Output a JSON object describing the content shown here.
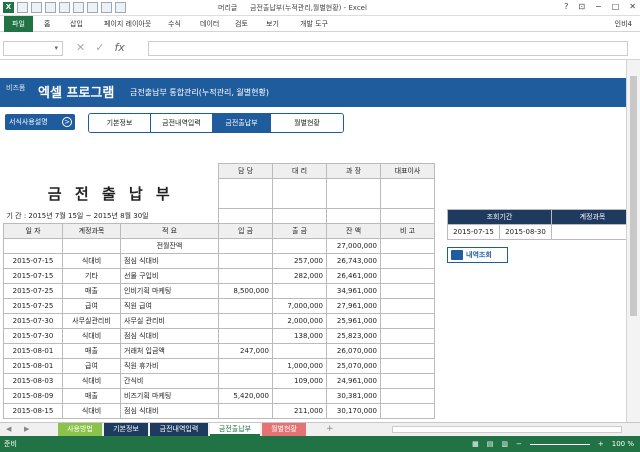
{
  "window": {
    "title": "금전출납부(누적관리,월별현황) - Excel",
    "controls": [
      "?",
      "⊡",
      "−",
      "□",
      "✕"
    ]
  },
  "qat_icons": [
    "excel-icon",
    "save-icon",
    "undo-icon",
    "redo-icon",
    "open-icon",
    "new-icon",
    "print-icon",
    "preview-icon",
    "checkbox-icon"
  ],
  "qat_label": "머리글",
  "ribbon": {
    "file": "파일",
    "tabs": [
      "홈",
      "삽입",
      "페이지 레이아웃",
      "수식",
      "데이터",
      "검토",
      "보기",
      "개발 도구"
    ],
    "user": "인비4"
  },
  "formula": {
    "name_box": "▾",
    "fx": "fx"
  },
  "banner": {
    "brand": "비즈폼",
    "program": "엑셀 프로그램",
    "subtitle": "금전출납부 통합관리(누적관리, 월별현황)"
  },
  "help_button": "서식사용설명",
  "help_icon": ">",
  "nav_tabs": [
    "기본정보",
    "금전내역입력",
    "금전출납부",
    "월별현황"
  ],
  "ledger": {
    "title": "금 전 출 납 부",
    "period": "기 간 : 2015년 7월 15일 ~ 2015년 8월 30일",
    "sign_headers": [
      "담 당",
      "대 리",
      "과 장",
      "대표이사"
    ],
    "columns": [
      "일 자",
      "계정과목",
      "적 요",
      "입 금",
      "출 금",
      "잔 액",
      "비 고"
    ],
    "opening": {
      "label": "전월잔액",
      "balance": "27,000,000"
    },
    "rows": [
      [
        "2015-07-15",
        "식대비",
        "점심 식대비",
        "",
        "257,000",
        "26,743,000",
        ""
      ],
      [
        "2015-07-15",
        "기타",
        "선물 구입비",
        "",
        "282,000",
        "26,461,000",
        ""
      ],
      [
        "2015-07-25",
        "매출",
        "인비기획 마케팅",
        "8,500,000",
        "",
        "34,961,000",
        ""
      ],
      [
        "2015-07-25",
        "급여",
        "직원 급여",
        "",
        "7,000,000",
        "27,961,000",
        ""
      ],
      [
        "2015-07-30",
        "사무실관리비",
        "사무실 관리비",
        "",
        "2,000,000",
        "25,961,000",
        ""
      ],
      [
        "2015-07-30",
        "식대비",
        "점심 식대비",
        "",
        "138,000",
        "25,823,000",
        ""
      ],
      [
        "2015-08-01",
        "매출",
        "거래처 입금액",
        "247,000",
        "",
        "26,070,000",
        ""
      ],
      [
        "2015-08-01",
        "급여",
        "직원 휴가비",
        "",
        "1,000,000",
        "25,070,000",
        ""
      ],
      [
        "2015-08-03",
        "식대비",
        "간식비",
        "",
        "109,000",
        "24,961,000",
        ""
      ],
      [
        "2015-08-09",
        "매출",
        "비즈기획 마케팅",
        "5,420,000",
        "",
        "30,381,000",
        ""
      ],
      [
        "2015-08-15",
        "식대비",
        "점심 식대비",
        "",
        "211,000",
        "30,170,000",
        ""
      ]
    ]
  },
  "condition": {
    "headers": [
      "조회기간",
      "계정과목"
    ],
    "from": "2015-07-15",
    "tilde": "~",
    "to": "2015-08-30",
    "account": ""
  },
  "search_button": "내역조회",
  "sheet_tabs": [
    {
      "label": "사용방법",
      "color": "#8bc34a"
    },
    {
      "label": "기본정보",
      "color": "#1f3a5f"
    },
    {
      "label": "금전내역입력",
      "color": "#1f3a5f"
    },
    {
      "label": "금전출납부",
      "color": "#217346"
    },
    {
      "label": "월별현황",
      "color": "#e57373"
    }
  ],
  "sheet_add": "+",
  "status": {
    "ready": "준비",
    "zoom": "100 %"
  }
}
